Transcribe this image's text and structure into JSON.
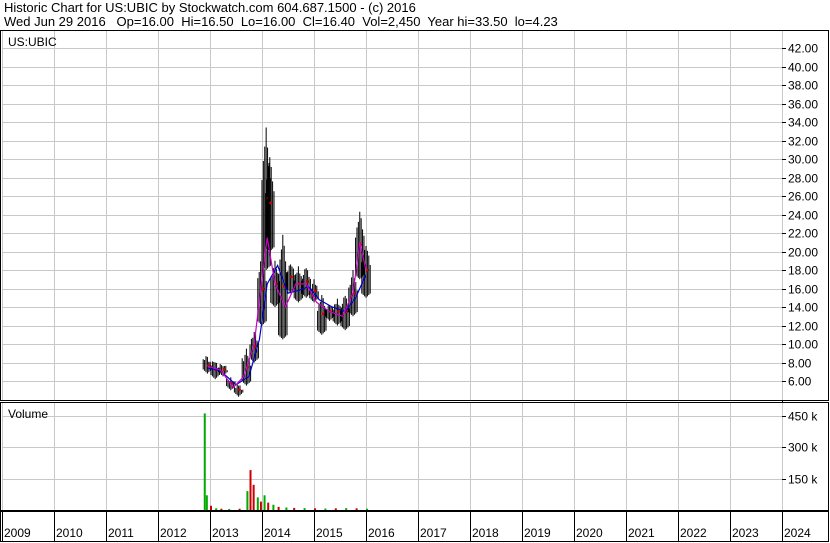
{
  "header": {
    "line1": "Historic Chart for US:UBIC by Stockwatch.com 604.687.1500 - (c) 2016",
    "line2": "Wed Jun 29 2016   Op=16.00  Hi=16.50  Lo=16.00  Cl=16.40  Vol=2,450  Year hi=33.50  lo=4.23"
  },
  "colors": {
    "price_bar": "#000000",
    "down_bar": "#cc0000",
    "ma_short": "#cc00cc",
    "ma_long": "#0000cc",
    "vol_up": "#00aa00",
    "vol_down": "#cc0000",
    "grid": "#c8c8c8"
  },
  "chart_data": [
    {
      "type": "line",
      "title": "US:UBIC",
      "ylim": [
        4.23,
        43
      ],
      "y_ticks": [
        "42.00",
        "40.00",
        "38.00",
        "36.00",
        "34.00",
        "32.00",
        "30.00",
        "28.00",
        "26.00",
        "24.00",
        "22.00",
        "20.00",
        "18.00",
        "16.00",
        "14.00",
        "12.00",
        "10.00",
        "8.00",
        "6.00"
      ],
      "y_tick_values": [
        42,
        40,
        38,
        36,
        34,
        32,
        30,
        28,
        26,
        24,
        22,
        20,
        18,
        16,
        14,
        12,
        10,
        8,
        6
      ],
      "x_categories": [
        "2009",
        "2010",
        "2011",
        "2012",
        "2013",
        "2014",
        "2015",
        "2016",
        "2017",
        "2018",
        "2019",
        "2020",
        "2021",
        "2022",
        "2023",
        "2024"
      ],
      "grid": true,
      "series": [
        {
          "style": "hi-lo bars",
          "values": [
            {
              "x": 2012.95,
              "lo": 6.8,
              "hi": 8.6
            },
            {
              "x": 2013.1,
              "lo": 6.2,
              "hi": 8.2
            },
            {
              "x": 2013.25,
              "lo": 6.5,
              "hi": 8.0
            },
            {
              "x": 2013.4,
              "lo": 5.0,
              "hi": 6.5
            },
            {
              "x": 2013.55,
              "lo": 4.3,
              "hi": 5.8
            },
            {
              "x": 2013.7,
              "lo": 5.5,
              "hi": 9.5
            },
            {
              "x": 2013.85,
              "lo": 8.0,
              "hi": 11.5
            },
            {
              "x": 2014.0,
              "lo": 12.0,
              "hi": 20.0
            },
            {
              "x": 2014.08,
              "lo": 18.0,
              "hi": 33.5
            },
            {
              "x": 2014.15,
              "lo": 20.0,
              "hi": 30.5
            },
            {
              "x": 2014.25,
              "lo": 14.0,
              "hi": 19.0
            },
            {
              "x": 2014.4,
              "lo": 10.5,
              "hi": 22.0
            },
            {
              "x": 2014.55,
              "lo": 15.5,
              "hi": 19.0
            },
            {
              "x": 2014.7,
              "lo": 14.5,
              "hi": 18.5
            },
            {
              "x": 2014.85,
              "lo": 15.0,
              "hi": 18.5
            },
            {
              "x": 2015.0,
              "lo": 14.5,
              "hi": 17.0
            },
            {
              "x": 2015.15,
              "lo": 11.0,
              "hi": 15.5
            },
            {
              "x": 2015.3,
              "lo": 12.5,
              "hi": 14.5
            },
            {
              "x": 2015.45,
              "lo": 12.0,
              "hi": 15.0
            },
            {
              "x": 2015.6,
              "lo": 11.5,
              "hi": 15.5
            },
            {
              "x": 2015.75,
              "lo": 13.0,
              "hi": 18.0
            },
            {
              "x": 2015.88,
              "lo": 17.0,
              "hi": 24.5
            },
            {
              "x": 2016.0,
              "lo": 15.0,
              "hi": 21.0
            }
          ]
        },
        {
          "name": "",
          "style": "short moving average",
          "x": [
            2012.95,
            2013.2,
            2013.45,
            2013.65,
            2013.85,
            2014.0,
            2014.1,
            2014.25,
            2014.45,
            2014.65,
            2014.85,
            2015.05,
            2015.3,
            2015.55,
            2015.75,
            2015.88,
            2016.0
          ],
          "values": [
            7.6,
            7.2,
            5.3,
            6.5,
            10.0,
            17.0,
            21.5,
            16.5,
            14.0,
            16.5,
            16.5,
            14.5,
            13.5,
            13.0,
            15.5,
            21.0,
            18.0
          ]
        },
        {
          "name": "",
          "style": "long moving average",
          "x": [
            2012.95,
            2013.2,
            2013.5,
            2013.75,
            2013.95,
            2014.1,
            2014.3,
            2014.5,
            2014.7,
            2014.9,
            2015.1,
            2015.35,
            2015.6,
            2015.8,
            2016.0
          ],
          "values": [
            7.4,
            7.1,
            5.6,
            6.5,
            10.5,
            16.5,
            18.5,
            15.5,
            15.8,
            16.2,
            14.8,
            14.0,
            13.5,
            15.0,
            17.5
          ]
        }
      ]
    },
    {
      "type": "bar",
      "title": "Volume",
      "y_ticks": [
        "450 k",
        "300 k",
        "150 k"
      ],
      "y_tick_values": [
        450000,
        300000,
        150000
      ],
      "ylim": [
        0,
        500000
      ],
      "bars": [
        {
          "x": 2012.88,
          "v": 460000,
          "up": true
        },
        {
          "x": 2012.92,
          "v": 70000,
          "up": true
        },
        {
          "x": 2013.0,
          "v": 20000,
          "up": false
        },
        {
          "x": 2013.1,
          "v": 8000,
          "up": true
        },
        {
          "x": 2013.2,
          "v": 6000,
          "up": false
        },
        {
          "x": 2013.35,
          "v": 5000,
          "up": true
        },
        {
          "x": 2013.55,
          "v": 6000,
          "up": false
        },
        {
          "x": 2013.7,
          "v": 90000,
          "up": true
        },
        {
          "x": 2013.76,
          "v": 190000,
          "up": false
        },
        {
          "x": 2013.82,
          "v": 120000,
          "up": false
        },
        {
          "x": 2013.9,
          "v": 60000,
          "up": true
        },
        {
          "x": 2013.96,
          "v": 40000,
          "up": false
        },
        {
          "x": 2014.03,
          "v": 70000,
          "up": true
        },
        {
          "x": 2014.1,
          "v": 35000,
          "up": false
        },
        {
          "x": 2014.2,
          "v": 25000,
          "up": true
        },
        {
          "x": 2014.3,
          "v": 15000,
          "up": false
        },
        {
          "x": 2014.45,
          "v": 12000,
          "up": true
        },
        {
          "x": 2014.6,
          "v": 10000,
          "up": false
        },
        {
          "x": 2014.8,
          "v": 9000,
          "up": true
        },
        {
          "x": 2015.0,
          "v": 8000,
          "up": false
        },
        {
          "x": 2015.2,
          "v": 7000,
          "up": true
        },
        {
          "x": 2015.4,
          "v": 8000,
          "up": false
        },
        {
          "x": 2015.6,
          "v": 9000,
          "up": true
        },
        {
          "x": 2015.8,
          "v": 8000,
          "up": false
        },
        {
          "x": 2016.0,
          "v": 6000,
          "up": true
        }
      ]
    }
  ]
}
